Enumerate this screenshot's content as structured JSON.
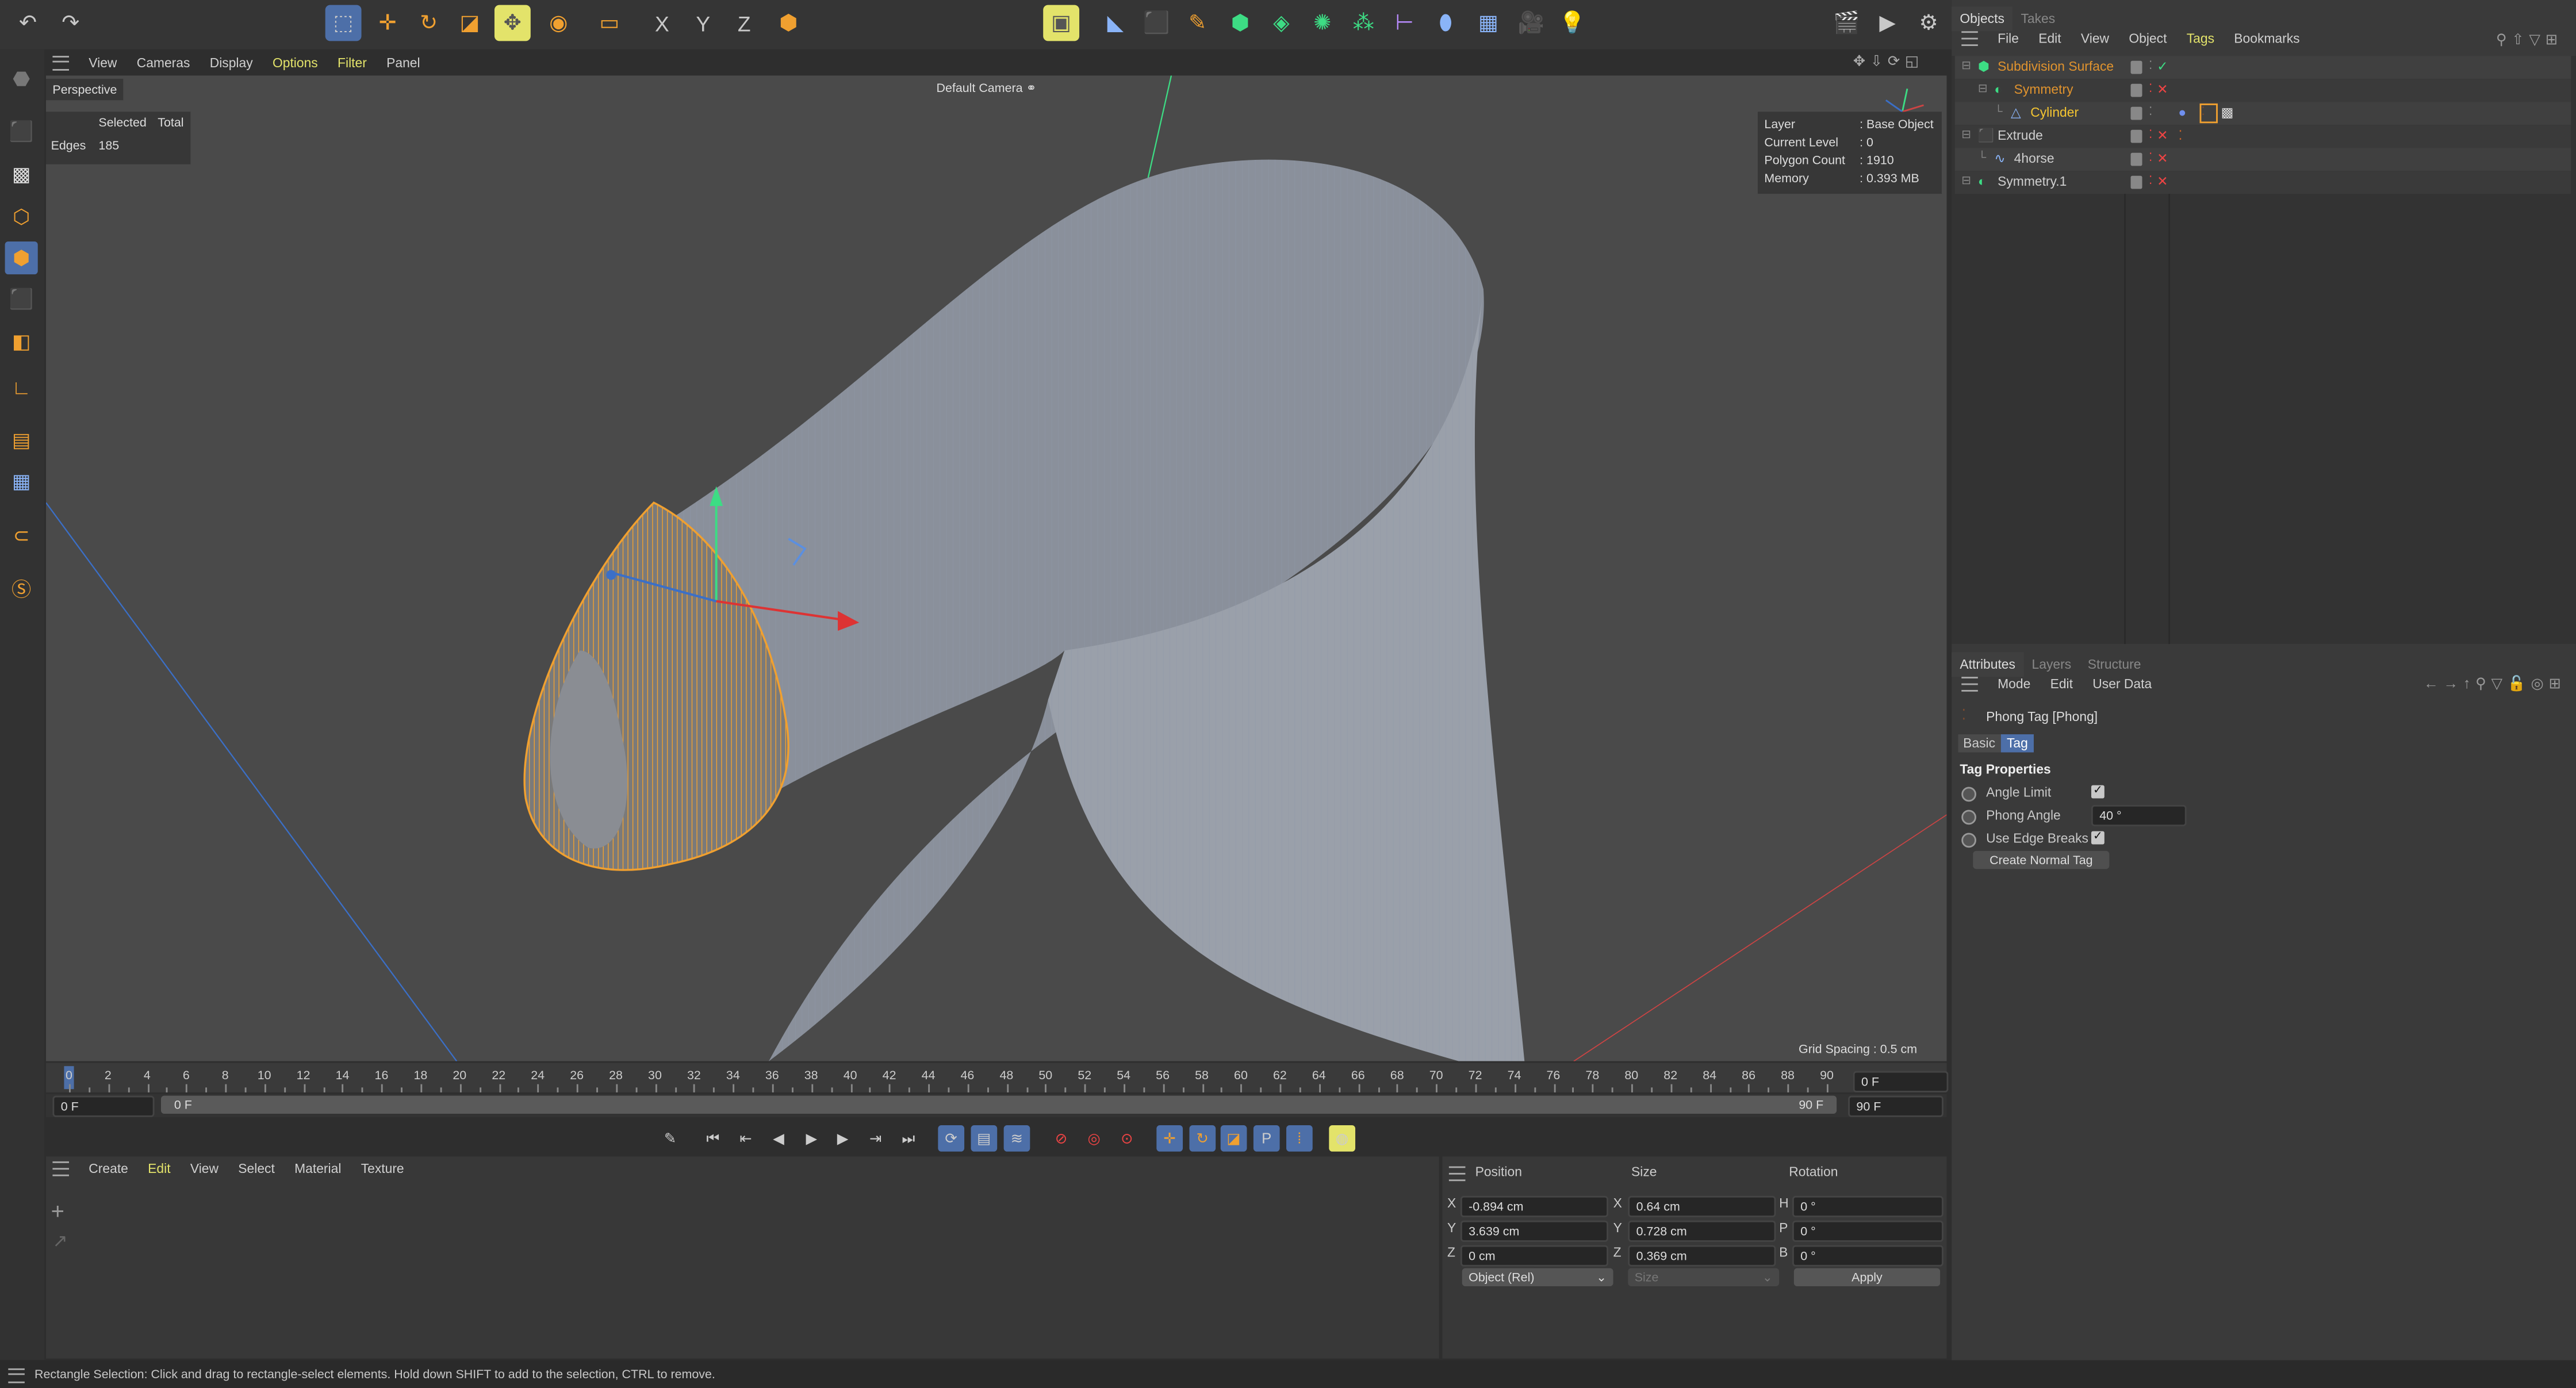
{
  "toolbar": {
    "icons": [
      "undo-icon",
      "redo-icon",
      "live-selection-icon",
      "move-icon",
      "rotate-icon",
      "scale-icon",
      "select-active-icon",
      "recent-tools-icon",
      "rectangle-selection-icon",
      "x-axis-lock-icon",
      "y-axis-lock-icon",
      "z-axis-lock-icon",
      "coordinate-system-icon",
      "render-region-icon",
      "cube-icon",
      "pen-icon",
      "subdivision-icon",
      "array-icon",
      "mograph-icon",
      "deformer-icon",
      "field-icon",
      "floor-icon",
      "camera-icon",
      "light-icon",
      "render-view-icon",
      "render-icon",
      "render-settings-icon"
    ],
    "axis_labels": {
      "x": "X",
      "y": "Y",
      "z": "Z"
    }
  },
  "viewport": {
    "menu": [
      "View",
      "Cameras",
      "Display",
      "Options",
      "Filter",
      "Panel"
    ],
    "highlighted_menu": [
      "Options",
      "Filter"
    ],
    "view_name": "Perspective",
    "camera": "Default Camera",
    "stats": {
      "col_selected": "Selected",
      "col_total": "Total",
      "row_label": "Edges",
      "row_value": "185"
    },
    "info": [
      {
        "label": "Layer",
        "value": ": Base Object"
      },
      {
        "label": "Current Level",
        "value": ": 0"
      },
      {
        "label": "Polygon Count",
        "value": ": 1910"
      },
      {
        "label": "Memory",
        "value": ": 0.393 MB"
      }
    ],
    "grid_spacing": "Grid Spacing : 0.5 cm",
    "selection_color": "#f0a030",
    "mesh_color": "#9aa3b3"
  },
  "timeline": {
    "ticks": [
      "0",
      "2",
      "4",
      "6",
      "8",
      "10",
      "12",
      "14",
      "16",
      "18",
      "20",
      "22",
      "24",
      "26",
      "28",
      "30",
      "32",
      "34",
      "36",
      "38",
      "40",
      "42",
      "44",
      "46",
      "48",
      "50",
      "52",
      "54",
      "56",
      "58",
      "60",
      "62",
      "64",
      "66",
      "68",
      "70",
      "72",
      "74",
      "76",
      "78",
      "80",
      "82",
      "84",
      "86",
      "88",
      "90"
    ],
    "current_frame": "0 F",
    "start": "0 F",
    "range_start": "0 F",
    "range_end": "90 F",
    "end": "90 F"
  },
  "playback": {
    "icons": [
      "record-keys-icon",
      "goto-start-icon",
      "prev-key-icon",
      "prev-frame-icon",
      "play-icon",
      "next-frame-icon",
      "next-key-icon",
      "goto-end-icon",
      "loop-icon",
      "timeline-icon",
      "scheme-icon",
      "autokey-icon",
      "keyframe-selection-icon",
      "record-icon",
      "key-position-icon",
      "key-rotation-icon",
      "key-scale-icon",
      "key-param-icon",
      "key-pla-icon",
      "motion-clip-icon"
    ]
  },
  "materials": {
    "menu": [
      "Create",
      "Edit",
      "View",
      "Select",
      "Material",
      "Texture"
    ],
    "highlighted": "Edit"
  },
  "coordinates": {
    "headers": [
      "Position",
      "Size",
      "Rotation"
    ],
    "rows": [
      {
        "pl": "X",
        "pos": "-0.894 cm",
        "sl": "X",
        "size": "0.64 cm",
        "rl": "H",
        "rot": "0 °"
      },
      {
        "pl": "Y",
        "pos": "3.639 cm",
        "sl": "Y",
        "size": "0.728 cm",
        "rl": "P",
        "rot": "0 °"
      },
      {
        "pl": "Z",
        "pos": "0 cm",
        "sl": "Z",
        "size": "0.369 cm",
        "rl": "B",
        "rot": "0 °"
      }
    ],
    "mode": "Object (Rel)",
    "size_mode": "Size",
    "apply": "Apply"
  },
  "objects": {
    "tabs": [
      "Objects",
      "Takes"
    ],
    "menu": [
      "File",
      "Edit",
      "View",
      "Object",
      "Tags",
      "Bookmarks"
    ],
    "highlighted": "Tags",
    "items": [
      {
        "name": "Subdivision Surface",
        "color": "#e0932e",
        "status": "check"
      },
      {
        "name": "Symmetry",
        "color": "#e0932e",
        "status": "x"
      },
      {
        "name": "Cylinder",
        "color": "#f4c531",
        "status": "none"
      },
      {
        "name": "Extrude",
        "color": "#cfcfcf",
        "status": "x"
      },
      {
        "name": "4horse",
        "color": "#cfcfcf",
        "status": "x"
      },
      {
        "name": "Symmetry.1",
        "color": "#cfcfcf",
        "status": "x"
      }
    ]
  },
  "attributes": {
    "tabs": [
      "Attributes",
      "Layers",
      "Structure"
    ],
    "menu": [
      "Mode",
      "Edit",
      "User Data"
    ],
    "title": "Phong Tag [Phong]",
    "subtabs": [
      "Basic",
      "Tag"
    ],
    "section": "Tag Properties",
    "angle_limit": {
      "label": "Angle Limit",
      "checked": true
    },
    "phong_angle": {
      "label": "Phong Angle",
      "value": "40 °"
    },
    "edge_breaks": {
      "label": "Use Edge Breaks",
      "checked": true
    },
    "create_button": "Create Normal Tag",
    "accent": "#4d6fa8"
  },
  "status": "Rectangle Selection: Click and drag to rectangle-select elements. Hold down SHIFT to add to the selection, CTRL to remove."
}
